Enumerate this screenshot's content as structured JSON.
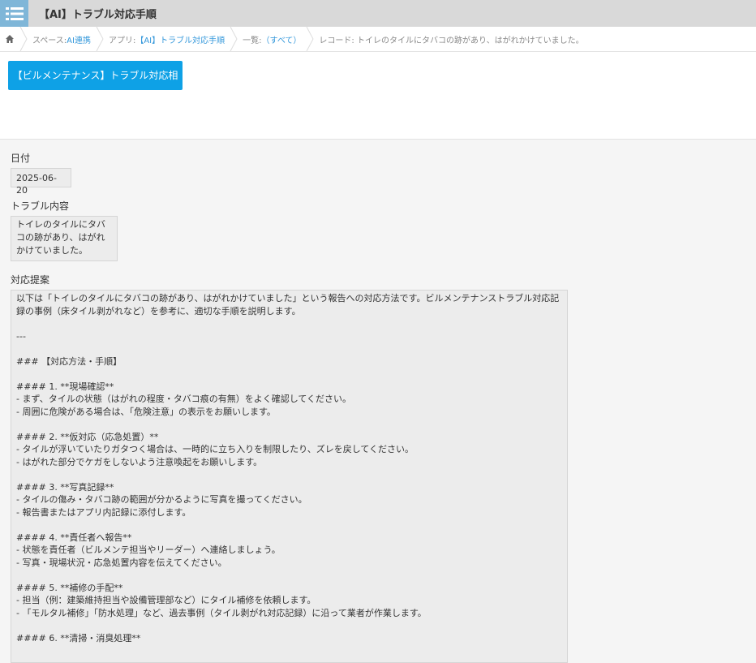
{
  "header": {
    "title": "【AI】トラブル対応手順",
    "app_icon": "list-icon"
  },
  "breadcrumb": {
    "home_icon": "home-icon",
    "space_prefix": "スペース: ",
    "space_link": "AI連携",
    "app_prefix": "アプリ: ",
    "app_link": "【AI】トラブル対応手順",
    "list_prefix": "一覧: ",
    "list_link": "（すべて）",
    "record_text": "レコード: トイレのタイルにタバコの跡があり、はがれかけていました。"
  },
  "action": {
    "button_label": "【ビルメンテナンス】トラブル対応相談"
  },
  "fields": {
    "date_label": "日付",
    "date_value": "2025-06-20",
    "trouble_label": "トラブル内容",
    "trouble_value": "トイレのタイルにタバコの跡があり、はがれかけていました。",
    "proposal_label": "対応提案",
    "proposal_value": "以下は「トイレのタイルにタバコの跡があり、はがれかけていました」という報告への対応方法です。ビルメンテナンストラブル対応記録の事例（床タイル剥がれなど）を参考に、適切な手順を説明します。\n\n---\n\n### 【対応方法・手順】\n\n#### 1. **現場確認**\n- まず、タイルの状態（はがれの程度・タバコ痕の有無）をよく確認してください。\n- 周囲に危険がある場合は、「危険注意」の表示をお願いします。\n\n#### 2. **仮対応（応急処置）**\n- タイルが浮いていたりガタつく場合は、一時的に立ち入りを制限したり、ズレを戻してください。\n- はがれた部分でケガをしないよう注意喚起をお願いします。\n\n#### 3. **写真記録**\n- タイルの傷み・タバコ跡の範囲が分かるように写真を撮ってください。\n- 報告書またはアプリ内記録に添付します。\n\n#### 4. **責任者へ報告**\n- 状態を責任者（ビルメンテ担当やリーダー）へ連絡しましょう。\n- 写真・現場状況・応急処置内容を伝えてください。\n\n#### 5. **補修の手配**\n- 担当（例：建築維持担当や設備管理部など）にタイル補修を依頼します。\n- 「モルタル補修」「防水処理」など、過去事例（タイル剥がれ対応記録）に沿って業者が作業します。\n\n#### 6. **清掃・消臭処理**"
  },
  "colors": {
    "accent": "#0ea1e6",
    "header_bg": "#d9d9d9",
    "app_icon_bg": "#7fb6d8",
    "link": "#3498db"
  }
}
